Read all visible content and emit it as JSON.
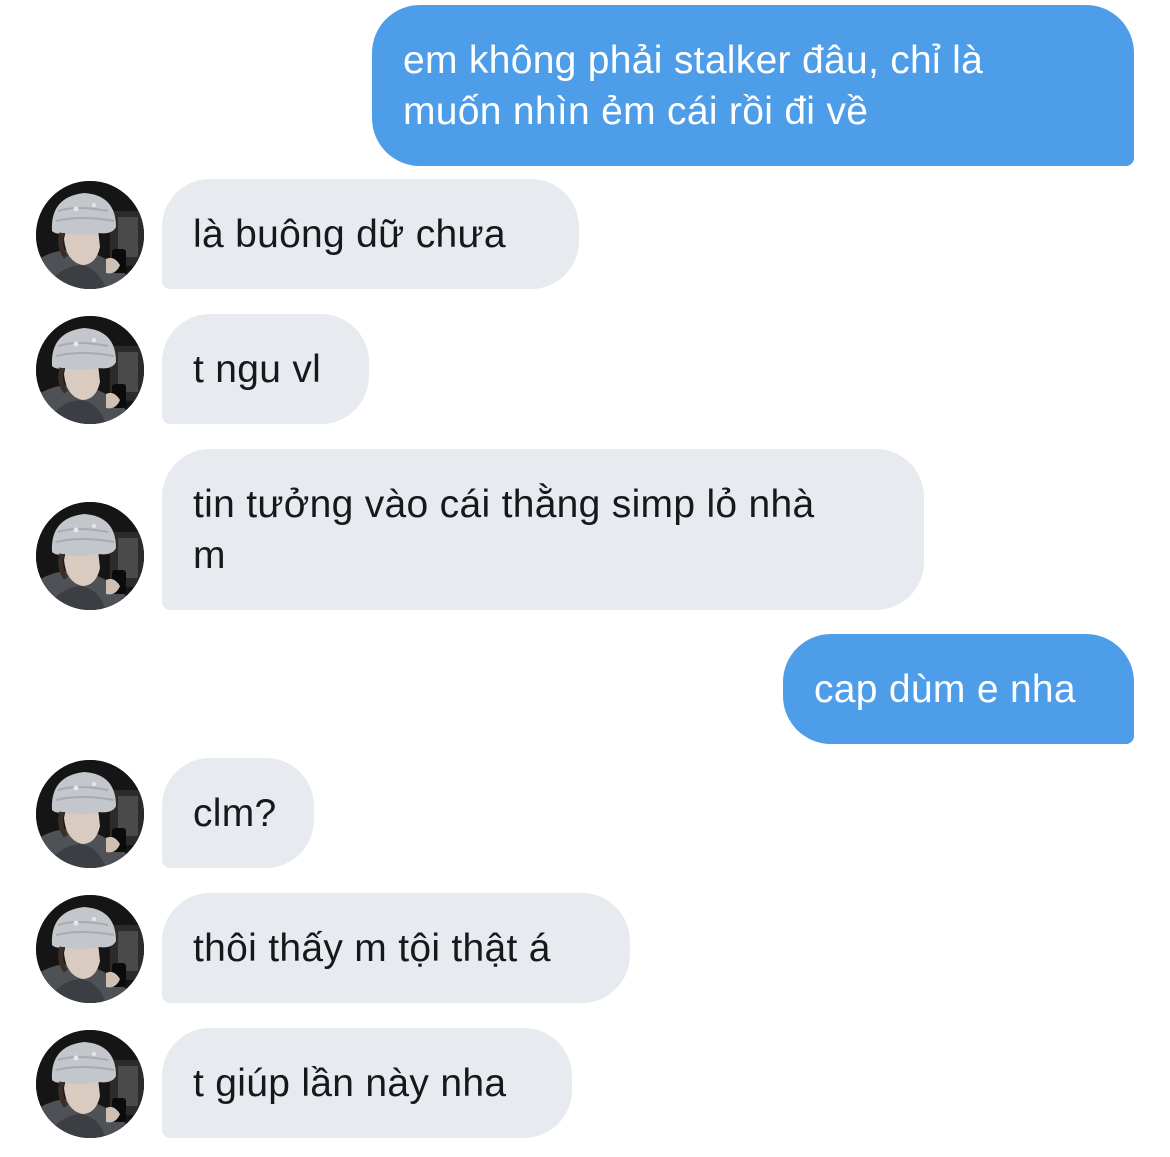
{
  "conversation": {
    "messages": [
      {
        "sender": "me",
        "text": "em không phải stalker đâu, chỉ là\nmuốn nhìn ẻm cái rồi đi về"
      },
      {
        "sender": "them",
        "text": "là buông dữ chưa"
      },
      {
        "sender": "them",
        "text": "t ngu vl"
      },
      {
        "sender": "them",
        "text": "tin tưởng vào cái thằng simp lỏ nhà\nm"
      },
      {
        "sender": "me",
        "text": "cap dùm e nha"
      },
      {
        "sender": "them",
        "text": "clm?"
      },
      {
        "sender": "them",
        "text": "thôi thấy m tội thật á"
      },
      {
        "sender": "them",
        "text": "t giúp lần này nha"
      }
    ]
  },
  "colors": {
    "sent_bubble": "#4d9de9",
    "received_bubble": "#e7ebf0",
    "sent_text": "#ffffff",
    "received_text": "#16181c"
  }
}
